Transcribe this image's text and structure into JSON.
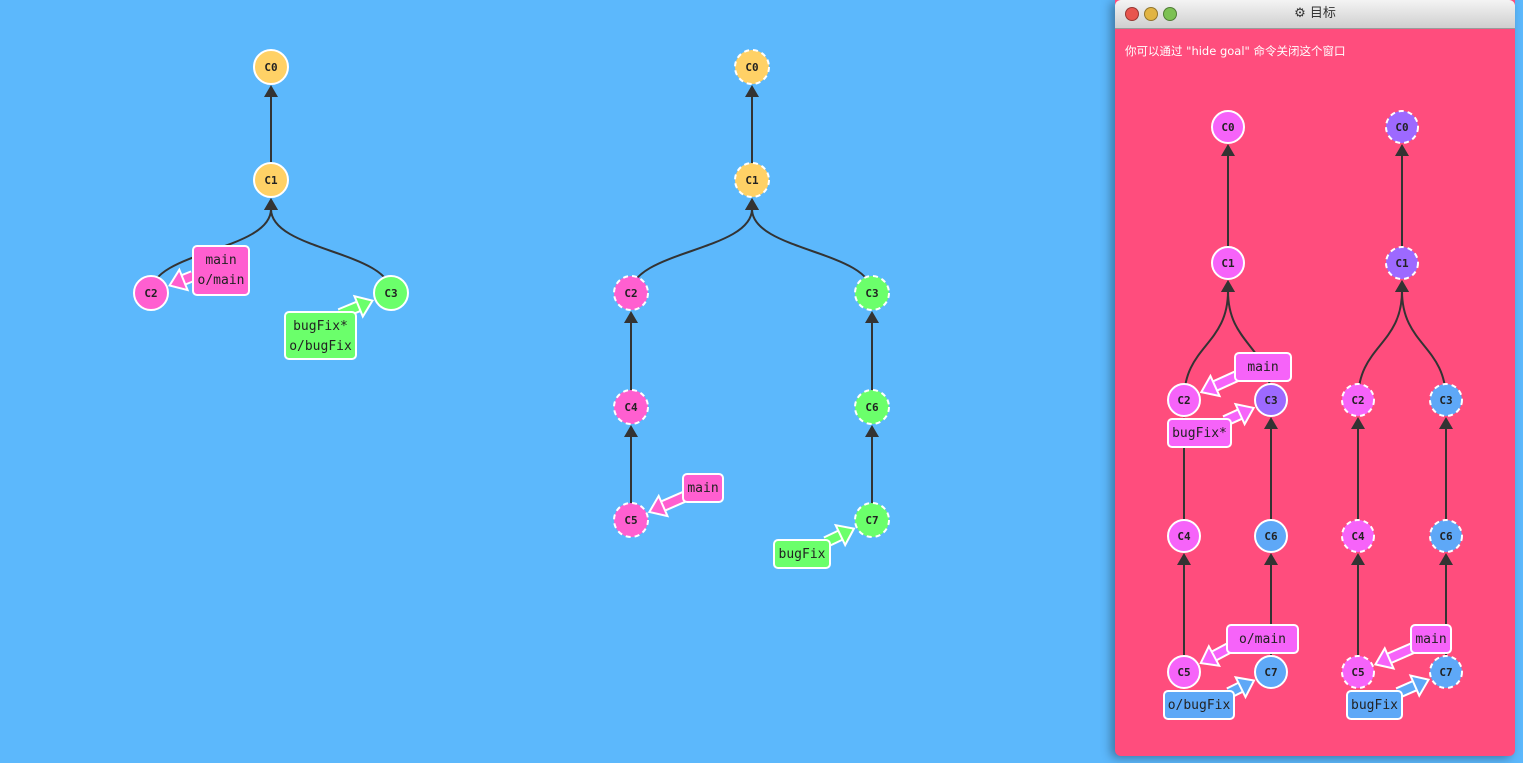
{
  "colors": {
    "background": "#5cb8fc",
    "c_orig": "#ffd166",
    "c_main": "#ff5fd0",
    "c_bug": "#6bff6b",
    "c_goal_local": "#f663f9",
    "c_goal_purple": "#9d69ff",
    "c_goal_blue": "#5ea8f7",
    "edge": "#333333",
    "goal_bg": "#ff4d7d"
  },
  "goal_window": {
    "title": "目标",
    "hint": "你可以通过 \"hide goal\" 命令关闭这个窗口"
  },
  "main_view": {
    "local": {
      "commits": [
        {
          "id": "C0",
          "color": "c_orig",
          "dashed": false
        },
        {
          "id": "C1",
          "color": "c_orig",
          "dashed": false
        },
        {
          "id": "C2",
          "color": "c_main",
          "dashed": false
        },
        {
          "id": "C3",
          "color": "c_bug",
          "dashed": false
        }
      ],
      "branches": [
        {
          "text": "main\no/main",
          "target": "C2",
          "color": "c_main"
        },
        {
          "text": "bugFix*\no/bugFix",
          "target": "C3",
          "color": "c_bug"
        }
      ]
    },
    "remote": {
      "commits": [
        {
          "id": "C0",
          "color": "c_orig",
          "dashed": true
        },
        {
          "id": "C1",
          "color": "c_orig",
          "dashed": true
        },
        {
          "id": "C2",
          "color": "c_main",
          "dashed": true
        },
        {
          "id": "C3",
          "color": "c_bug",
          "dashed": true
        },
        {
          "id": "C4",
          "color": "c_main",
          "dashed": true
        },
        {
          "id": "C6",
          "color": "c_bug",
          "dashed": true
        },
        {
          "id": "C5",
          "color": "c_main",
          "dashed": true
        },
        {
          "id": "C7",
          "color": "c_bug",
          "dashed": true
        }
      ],
      "branches": [
        {
          "text": "main",
          "target": "C5",
          "color": "c_main"
        },
        {
          "text": "bugFix",
          "target": "C7",
          "color": "c_bug"
        }
      ]
    }
  },
  "goal_view": {
    "local": {
      "commits": [
        {
          "id": "C0",
          "color": "c_goal_local",
          "dashed": false
        },
        {
          "id": "C1",
          "color": "c_goal_local",
          "dashed": false
        },
        {
          "id": "C2",
          "color": "c_goal_local",
          "dashed": false
        },
        {
          "id": "C3",
          "color": "c_goal_purple",
          "dashed": false
        },
        {
          "id": "C4",
          "color": "c_goal_local",
          "dashed": false
        },
        {
          "id": "C6",
          "color": "c_goal_blue",
          "dashed": false
        },
        {
          "id": "C5",
          "color": "c_goal_local",
          "dashed": false
        },
        {
          "id": "C7",
          "color": "c_goal_blue",
          "dashed": false
        }
      ],
      "branches": [
        {
          "text": "main",
          "target": "C2",
          "color": "c_goal_local"
        },
        {
          "text": "bugFix*",
          "target": "C3",
          "color": "c_goal_local"
        },
        {
          "text": "o/main",
          "target": "C5",
          "color": "c_goal_local"
        },
        {
          "text": "o/bugFix",
          "target": "C7",
          "color": "c_goal_blue"
        }
      ]
    },
    "remote": {
      "commits": [
        {
          "id": "C0",
          "color": "c_goal_purple",
          "dashed": true
        },
        {
          "id": "C1",
          "color": "c_goal_purple",
          "dashed": true
        },
        {
          "id": "C2",
          "color": "c_goal_local",
          "dashed": true
        },
        {
          "id": "C3",
          "color": "c_goal_blue",
          "dashed": true
        },
        {
          "id": "C4",
          "color": "c_goal_local",
          "dashed": true
        },
        {
          "id": "C6",
          "color": "c_goal_blue",
          "dashed": true
        },
        {
          "id": "C5",
          "color": "c_goal_local",
          "dashed": true
        },
        {
          "id": "C7",
          "color": "c_goal_blue",
          "dashed": true
        }
      ],
      "branches": [
        {
          "text": "main",
          "target": "C5",
          "color": "c_goal_local"
        },
        {
          "text": "bugFix",
          "target": "C7",
          "color": "c_goal_blue"
        }
      ]
    }
  }
}
